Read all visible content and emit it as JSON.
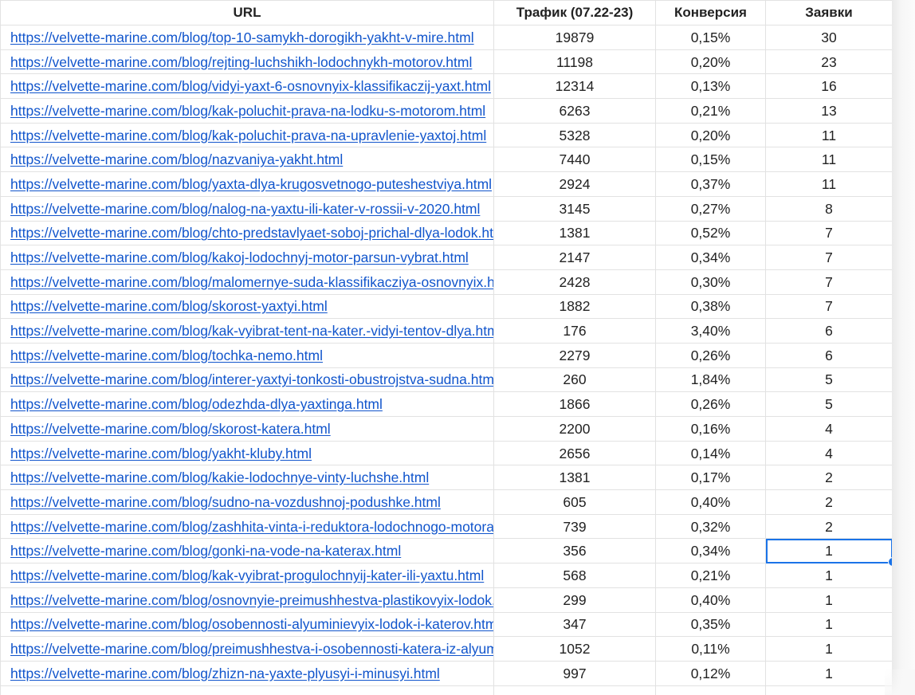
{
  "table": {
    "headers": {
      "url": "URL",
      "traffic": "Трафик (07.22-23)",
      "conversion": "Конверсия",
      "requests": "Заявки"
    },
    "rows": [
      {
        "url": "https://velvette-marine.com/blog/top-10-samykh-dorogikh-yakht-v-mire.html",
        "traffic": "19879",
        "conversion": "0,15%",
        "requests": "30"
      },
      {
        "url": "https://velvette-marine.com/blog/rejting-luchshikh-lodochnykh-motorov.html",
        "traffic": "11198",
        "conversion": "0,20%",
        "requests": "23"
      },
      {
        "url": "https://velvette-marine.com/blog/vidyi-yaxt-6-osnovnyix-klassifikaczij-yaxt.html",
        "traffic": "12314",
        "conversion": "0,13%",
        "requests": "16"
      },
      {
        "url": "https://velvette-marine.com/blog/kak-poluchit-prava-na-lodku-s-motorom.html",
        "traffic": "6263",
        "conversion": "0,21%",
        "requests": "13"
      },
      {
        "url": "https://velvette-marine.com/blog/kak-poluchit-prava-na-upravlenie-yaxtoj.html",
        "traffic": "5328",
        "conversion": "0,20%",
        "requests": "11"
      },
      {
        "url": "https://velvette-marine.com/blog/nazvaniya-yakht.html",
        "traffic": "7440",
        "conversion": "0,15%",
        "requests": "11"
      },
      {
        "url": "https://velvette-marine.com/blog/yaxta-dlya-krugosvetnogo-puteshestviya.html",
        "traffic": "2924",
        "conversion": "0,37%",
        "requests": "11"
      },
      {
        "url": "https://velvette-marine.com/blog/nalog-na-yaxtu-ili-kater-v-rossii-v-2020.html",
        "traffic": "3145",
        "conversion": "0,27%",
        "requests": "8"
      },
      {
        "url": "https://velvette-marine.com/blog/chto-predstavlyaet-soboj-prichal-dlya-lodok.html",
        "traffic": "1381",
        "conversion": "0,52%",
        "requests": "7"
      },
      {
        "url": "https://velvette-marine.com/blog/kakoj-lodochnyj-motor-parsun-vybrat.html",
        "traffic": "2147",
        "conversion": "0,34%",
        "requests": "7"
      },
      {
        "url": "https://velvette-marine.com/blog/malomernye-suda-klassifikacziya-osnovnyix.html",
        "traffic": "2428",
        "conversion": "0,30%",
        "requests": "7"
      },
      {
        "url": "https://velvette-marine.com/blog/skorost-yaxtyi.html",
        "traffic": "1882",
        "conversion": "0,38%",
        "requests": "7"
      },
      {
        "url": "https://velvette-marine.com/blog/kak-vyibrat-tent-na-kater.-vidyi-tentov-dlya.html",
        "traffic": "176",
        "conversion": "3,40%",
        "requests": "6"
      },
      {
        "url": "https://velvette-marine.com/blog/tochka-nemo.html",
        "traffic": "2279",
        "conversion": "0,26%",
        "requests": "6"
      },
      {
        "url": "https://velvette-marine.com/blog/interer-yaxtyi-tonkosti-obustrojstva-sudna.html",
        "traffic": "260",
        "conversion": "1,84%",
        "requests": "5"
      },
      {
        "url": "https://velvette-marine.com/blog/odezhda-dlya-yaxtinga.html",
        "traffic": "1866",
        "conversion": "0,26%",
        "requests": "5"
      },
      {
        "url": "https://velvette-marine.com/blog/skorost-katera.html",
        "traffic": "2200",
        "conversion": "0,16%",
        "requests": "4"
      },
      {
        "url": "https://velvette-marine.com/blog/yakht-kluby.html",
        "traffic": "2656",
        "conversion": "0,14%",
        "requests": "4"
      },
      {
        "url": "https://velvette-marine.com/blog/kakie-lodochnye-vinty-luchshe.html",
        "traffic": "1381",
        "conversion": "0,17%",
        "requests": "2"
      },
      {
        "url": "https://velvette-marine.com/blog/sudno-na-vozdushnoj-podushke.html",
        "traffic": "605",
        "conversion": "0,40%",
        "requests": "2"
      },
      {
        "url": "https://velvette-marine.com/blog/zashhita-vinta-i-reduktora-lodochnogo-motora.html",
        "traffic": "739",
        "conversion": "0,32%",
        "requests": "2"
      },
      {
        "url": "https://velvette-marine.com/blog/gonki-na-vode-na-katerax.html",
        "traffic": "356",
        "conversion": "0,34%",
        "requests": "1"
      },
      {
        "url": "https://velvette-marine.com/blog/kak-vyibrat-progulochnyij-kater-ili-yaxtu.html",
        "traffic": "568",
        "conversion": "0,21%",
        "requests": "1"
      },
      {
        "url": "https://velvette-marine.com/blog/osnovnyie-preimushhestva-plastikovyix-lodok.html",
        "traffic": "299",
        "conversion": "0,40%",
        "requests": "1"
      },
      {
        "url": "https://velvette-marine.com/blog/osobennosti-alyuminievyix-lodok-i-katerov.html",
        "traffic": "347",
        "conversion": "0,35%",
        "requests": "1"
      },
      {
        "url": "https://velvette-marine.com/blog/preimushhestva-i-osobennosti-katera-iz-alyuminiya.html",
        "traffic": "1052",
        "conversion": "0,11%",
        "requests": "1"
      },
      {
        "url": "https://velvette-marine.com/blog/zhizn-na-yaxte-plyusyi-i-minusyi.html",
        "traffic": "997",
        "conversion": "0,12%",
        "requests": "1"
      }
    ],
    "selected_row_index": 21,
    "selected_column": "requests"
  },
  "colors": {
    "link": "#1155cc",
    "grid": "#e2e2e2",
    "selection": "#1a73e8"
  }
}
